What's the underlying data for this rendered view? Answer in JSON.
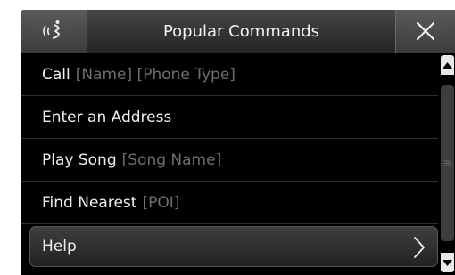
{
  "header": {
    "title": "Popular Commands",
    "voice_icon": "voice-command-icon",
    "close_icon": "close-icon"
  },
  "commands": [
    {
      "command": "Call",
      "placeholder": "[Name] [Phone Type]"
    },
    {
      "command": "Enter an Address",
      "placeholder": ""
    },
    {
      "command": "Play Song",
      "placeholder": "[Song Name]"
    },
    {
      "command": "Find Nearest",
      "placeholder": "[POI]"
    }
  ],
  "help": {
    "label": "Help",
    "icon": "chevron-right-icon"
  },
  "scrollbar": {
    "position": 0.0
  },
  "colors": {
    "background": "#000000",
    "text": "#f0f0f0",
    "placeholder": "#6f6f6f",
    "header": "#3a3a3a"
  }
}
